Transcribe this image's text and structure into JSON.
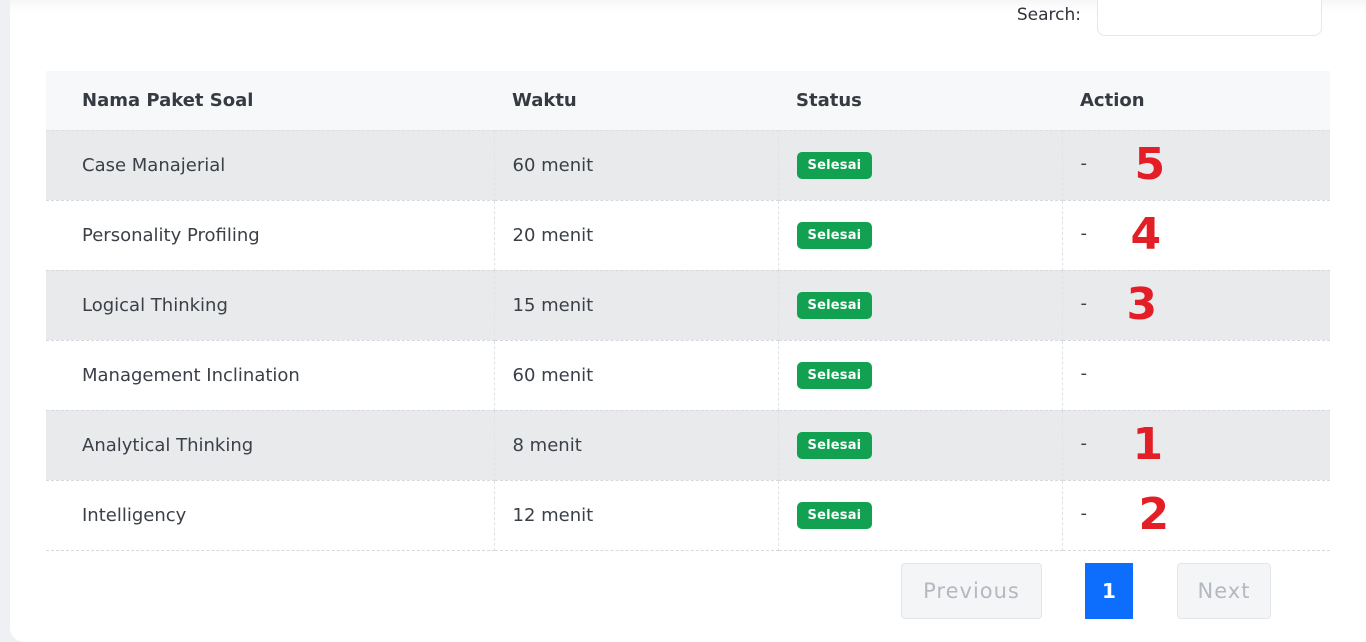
{
  "search": {
    "label": "Search:",
    "value": "",
    "placeholder": ""
  },
  "table": {
    "headers": [
      "Nama Paket Soal",
      "Waktu",
      "Status",
      "Action"
    ],
    "rows": [
      {
        "name": "Case Manajerial",
        "time": "60 menit",
        "status": "Selesai",
        "action": "-",
        "mark": "5"
      },
      {
        "name": "Personality Profiling",
        "time": "20 menit",
        "status": "Selesai",
        "action": "-",
        "mark": "4"
      },
      {
        "name": "Logical Thinking",
        "time": "15 menit",
        "status": "Selesai",
        "action": "-",
        "mark": "3"
      },
      {
        "name": "Management Inclination",
        "time": "60 menit",
        "status": "Selesai",
        "action": "-",
        "mark": ""
      },
      {
        "name": "Analytical Thinking",
        "time": "8 menit",
        "status": "Selesai",
        "action": "-",
        "mark": "1"
      },
      {
        "name": "Intelligency",
        "time": "12 menit",
        "status": "Selesai",
        "action": "-",
        "mark": "2"
      }
    ]
  },
  "pagination": {
    "previous": "Previous",
    "current": "1",
    "next": "Next"
  },
  "colors": {
    "status_badge": "#12a150",
    "active_page": "#0d6efd",
    "annotation": "#e41e26"
  }
}
